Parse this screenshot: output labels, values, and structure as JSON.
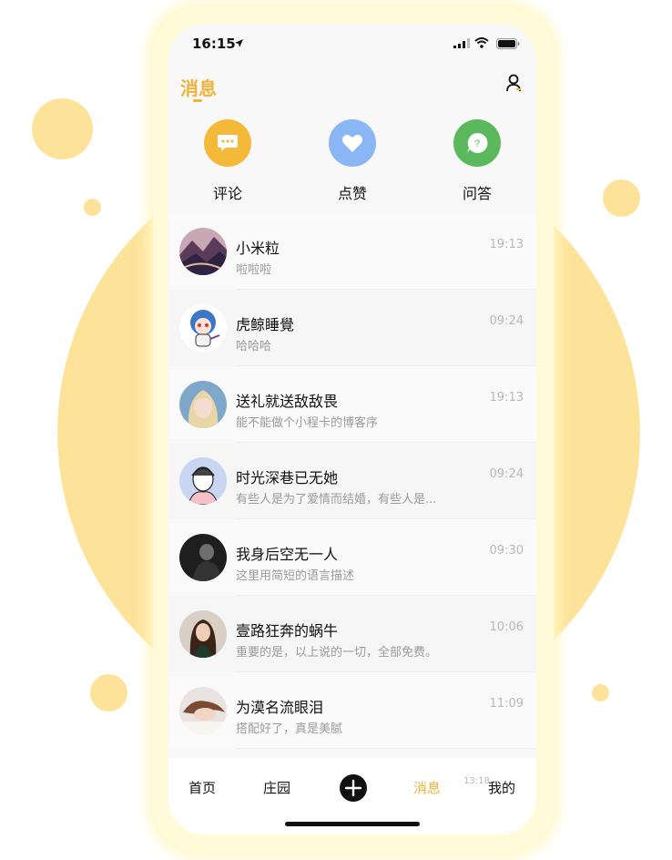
{
  "status_bar": {
    "time": "16:15"
  },
  "header": {
    "title": "消息"
  },
  "quick_actions": [
    {
      "label": "评论",
      "icon": "comment-bubble-icon",
      "color": "#f5b93a"
    },
    {
      "label": "点赞",
      "icon": "heart-icon",
      "color": "#8ab6f5"
    },
    {
      "label": "问答",
      "icon": "question-bubble-icon",
      "color": "#5cb85c"
    }
  ],
  "messages": [
    {
      "name": "小米粒",
      "preview": "啦啦啦",
      "time": "19:13",
      "avatar": "mountain-art-avatar"
    },
    {
      "name": "虎鲸睡覺",
      "preview": "哈哈哈",
      "time": "09:24",
      "avatar": "anime-character-avatar"
    },
    {
      "name": "送礼就送敌敌畏",
      "preview": "能不能做个小程卡的博客序",
      "time": "19:13",
      "avatar": "blonde-girl-avatar"
    },
    {
      "name": "时光深巷已无她",
      "preview": "有些人是为了爱情而结婚，有些人是...",
      "time": "09:24",
      "avatar": "illustrated-girl-avatar"
    },
    {
      "name": "我身后空无一人",
      "preview": "这里用简短的语言描述",
      "time": "09:30",
      "avatar": "dark-portrait-avatar"
    },
    {
      "name": "壹路狂奔的蜗牛",
      "preview": "重要的是，以上说的一切，全部免费。",
      "time": "10:06",
      "avatar": "woman-portrait-avatar"
    },
    {
      "name": "为漠名流眼泪",
      "preview": "搭配好了，真是美腻",
      "time": "11:09",
      "avatar": "sleeping-girl-avatar"
    }
  ],
  "tab_bar": {
    "home": "首页",
    "manor": "庄园",
    "messages": "消息",
    "overlap_time": "13:18",
    "mine": "我的"
  },
  "colors": {
    "accent": "#f0b33a",
    "background_blob": "#fde39a"
  }
}
